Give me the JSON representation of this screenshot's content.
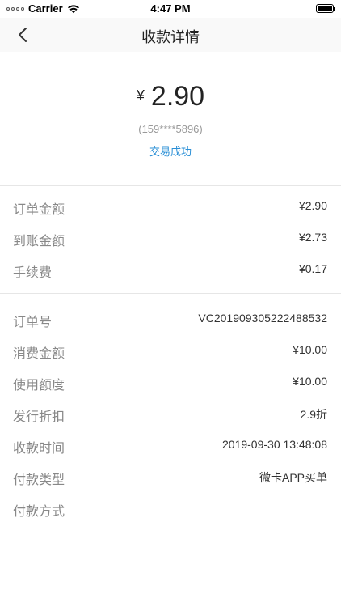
{
  "status_bar": {
    "carrier": "Carrier",
    "time": "4:47 PM"
  },
  "nav": {
    "title": "收款详情"
  },
  "amount": {
    "currency": "¥",
    "value": "2.90",
    "account": "(159****5896)",
    "status": "交易成功"
  },
  "group1": [
    {
      "label": "订单金额",
      "value": "¥2.90"
    },
    {
      "label": "到账金额",
      "value": "¥2.73"
    },
    {
      "label": "手续费",
      "value": "¥0.17"
    }
  ],
  "group2": [
    {
      "label": "订单号",
      "value": "VC201909305222488532"
    },
    {
      "label": "消费金额",
      "value": "¥10.00"
    },
    {
      "label": "使用额度",
      "value": "¥10.00"
    },
    {
      "label": "发行折扣",
      "value": "2.9折"
    },
    {
      "label": "收款时间",
      "value": "2019-09-30 13:48:08"
    },
    {
      "label": "付款类型",
      "value": "微卡APP买单"
    },
    {
      "label": "付款方式",
      "value": ""
    }
  ],
  "colors": {
    "accent": "#2a8fd6",
    "label": "#888888",
    "divider": "#e6e6e6"
  }
}
